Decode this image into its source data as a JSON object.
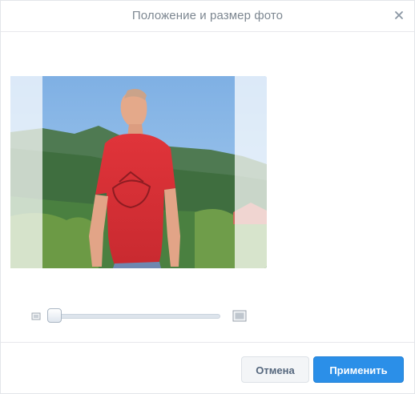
{
  "dialog": {
    "title": "Положение и размер фото",
    "close_icon": "close-icon"
  },
  "photo": {
    "description_icon": "profile-photo"
  },
  "zoom": {
    "min_icon": "zoom-out-icon",
    "max_icon": "zoom-in-icon",
    "level": 0.0
  },
  "footer": {
    "cancel_label": "Отмена",
    "apply_label": "Применить"
  },
  "colors": {
    "accent": "#2b8fe8",
    "title_text": "#7d8791",
    "cancel_text": "#55677d"
  }
}
